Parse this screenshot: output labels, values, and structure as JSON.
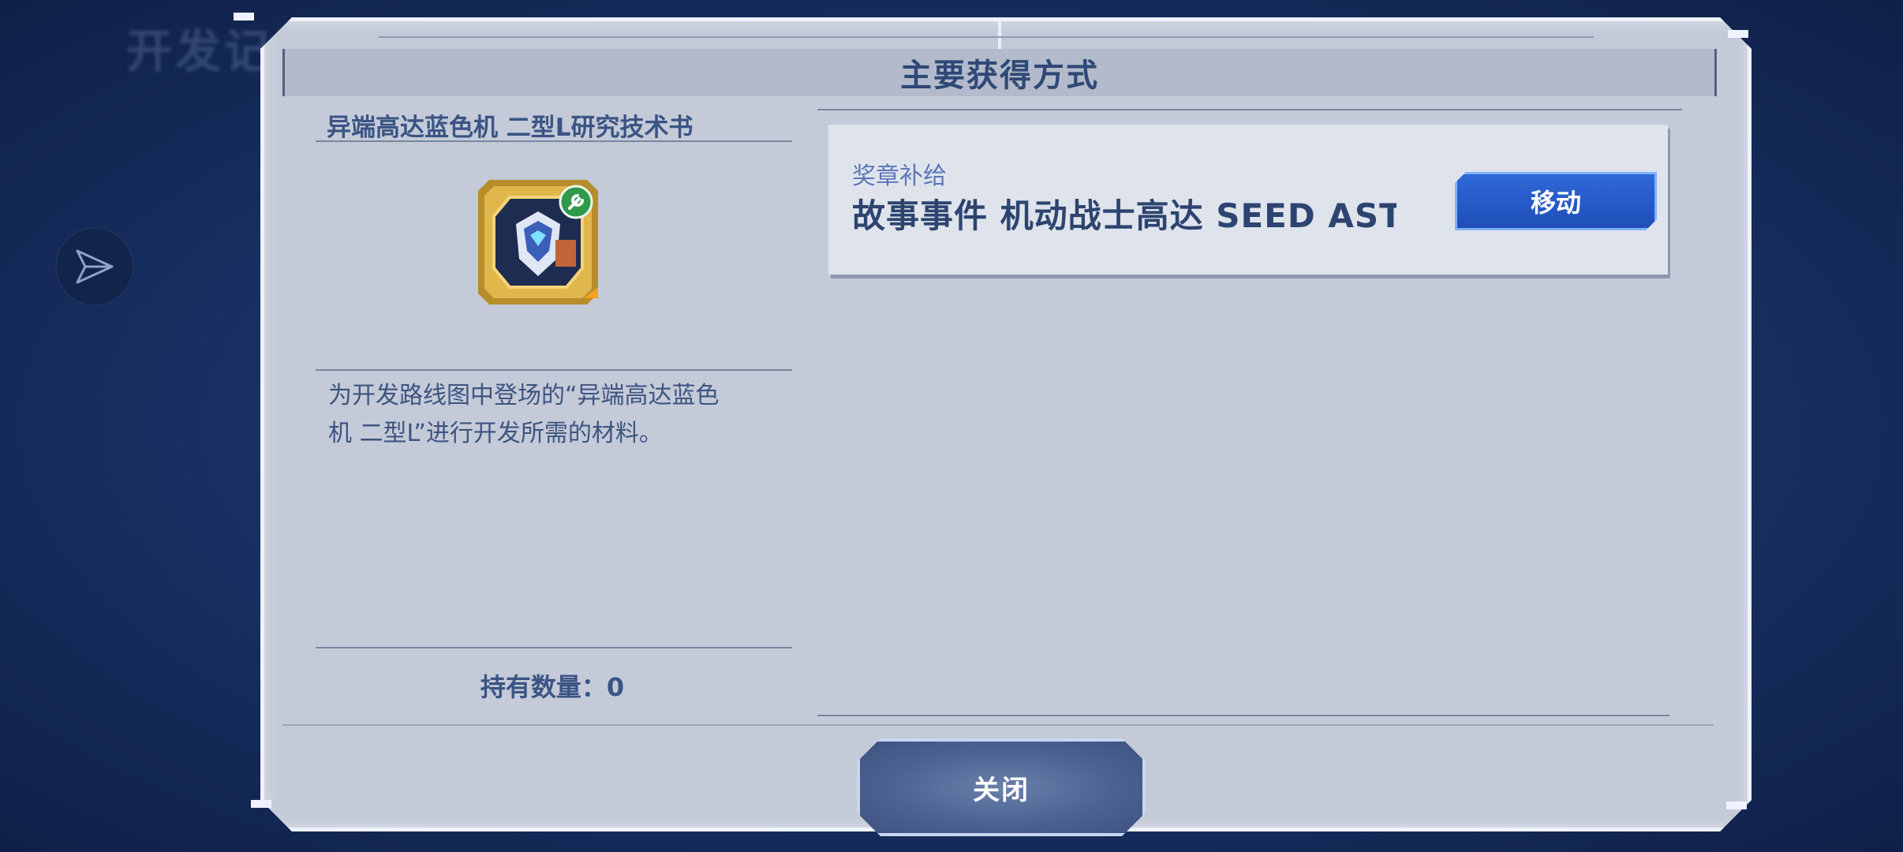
{
  "background": {
    "title": "开发记"
  },
  "dialog": {
    "title": "主要获得方式",
    "item": {
      "name": "异端高达蓝色机 二型L研究技术书",
      "icon": "gundam-tech-book-icon",
      "description_line1": "为开发路线图中登场的“异端高达蓝色",
      "description_line2": "机 二型L”进行开发所需的材料。",
      "owned": "持有数量：0"
    },
    "sources": [
      {
        "category": "奖章补给",
        "name": "故事事件 机动战士高达 SEED ASTRAY",
        "action_label": "移动"
      }
    ],
    "close_label": "关闭"
  },
  "colors": {
    "accent_blue": "#2a5fcf",
    "title_text": "#2f4876",
    "panel_bg": "#c4cad8"
  }
}
